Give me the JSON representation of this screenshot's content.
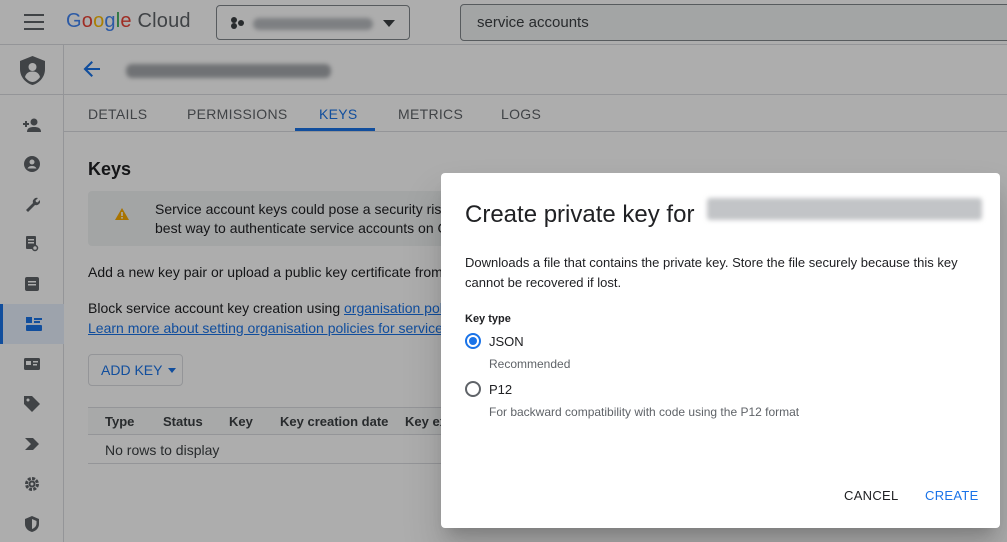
{
  "topbar": {
    "logo_letters": [
      "G",
      "o",
      "o",
      "g",
      "l",
      "e"
    ],
    "logo_cloud": "Cloud",
    "search_value": "service accounts"
  },
  "header": {
    "back_icon": "arrow-left-icon"
  },
  "tabs": [
    {
      "label": "DETAILS"
    },
    {
      "label": "PERMISSIONS"
    },
    {
      "label": "KEYS"
    },
    {
      "label": "METRICS"
    },
    {
      "label": "LOGS"
    }
  ],
  "active_tab": "KEYS",
  "content": {
    "title": "Keys",
    "warning_line1": "Service account keys could pose a security risk if",
    "warning_line2": "best way to authenticate service accounts on Goo",
    "info_text": "Add a new key pair or upload a public key certificate from an e",
    "block_prefix": "Block service account key creation using ",
    "block_link": "organisation policies",
    "learn_link": "Learn more about setting organisation policies for service acc",
    "add_key_label": "ADD KEY",
    "table_headers": [
      "Type",
      "Status",
      "Key",
      "Key creation date",
      "Key ex"
    ],
    "empty_text": "No rows to display"
  },
  "dialog": {
    "title": "Create private key for",
    "description": "Downloads a file that contains the private key. Store the file securely because this key cannot be recovered if lost.",
    "key_type_label": "Key type",
    "options": [
      {
        "label": "JSON",
        "description": "Recommended",
        "checked": true
      },
      {
        "label": "P12",
        "description": "For backward compatibility with code using the P12 format",
        "checked": false
      }
    ],
    "cancel_label": "CANCEL",
    "create_label": "CREATE"
  },
  "colors": {
    "accent": "#1a73e8",
    "scrim": "rgba(0,0,0,0.32)",
    "warning": "#f9ab00"
  }
}
